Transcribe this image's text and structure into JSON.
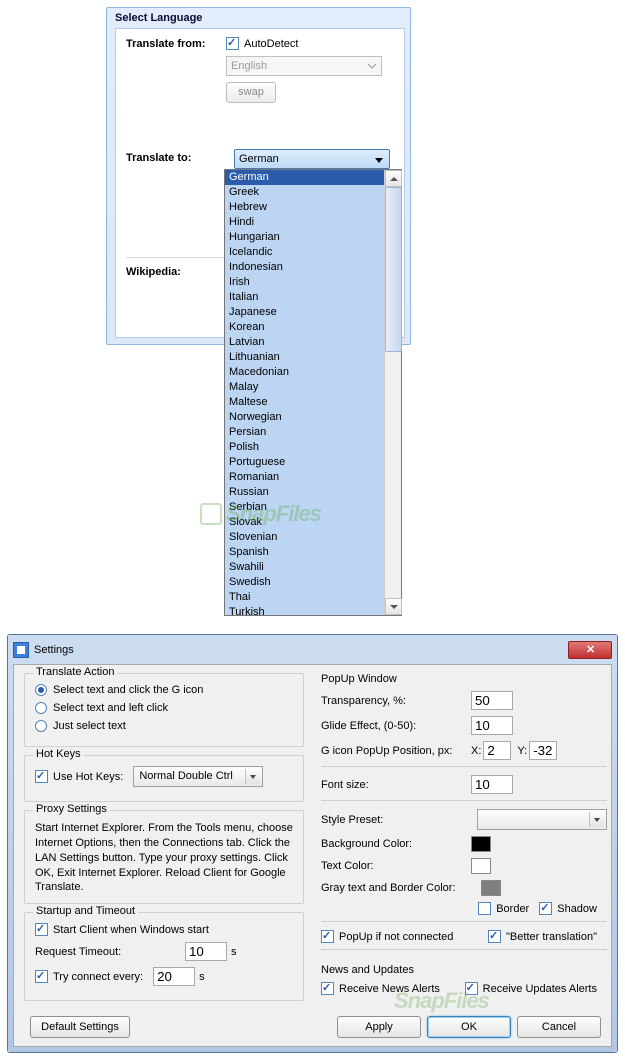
{
  "watermark": "SnapFiles",
  "selectLanguage": {
    "title": "Select Language",
    "fromLabel": "Translate from:",
    "autoDetectLabel": "AutoDetect",
    "autoDetectChecked": true,
    "fromSelected": "English",
    "swapLabel": "swap",
    "toLabel": "Translate to:",
    "toSelected": "German",
    "wikipediaLabel": "Wikipedia:",
    "options": [
      "German",
      "Greek",
      "Hebrew",
      "Hindi",
      "Hungarian",
      "Icelandic",
      "Indonesian",
      "Irish",
      "Italian",
      "Japanese",
      "Korean",
      "Latvian",
      "Lithuanian",
      "Macedonian",
      "Malay",
      "Maltese",
      "Norwegian",
      "Persian",
      "Polish",
      "Portuguese",
      "Romanian",
      "Russian",
      "Serbian",
      "Slovak",
      "Slovenian",
      "Spanish",
      "Swahili",
      "Swedish",
      "Thai",
      "Turkish"
    ]
  },
  "settings": {
    "title": "Settings",
    "translateAction": {
      "legend": "Translate Action",
      "o1": "Select text and click the G icon",
      "o2": "Select text and left click",
      "o3": "Just select text",
      "selected": 0
    },
    "hotKeys": {
      "legend": "Hot Keys",
      "useLabel": "Use Hot Keys:",
      "useChecked": true,
      "modeValue": "Normal Double Ctrl"
    },
    "proxy": {
      "legend": "Proxy Settings",
      "text": "Start Internet Explorer. From the Tools menu, choose Internet Options, then the Connections tab. Click the LAN Settings button. Type your proxy settings. Click OK, Exit Internet Explorer. Reload Client for Google Translate."
    },
    "startup": {
      "legend": "Startup and Timeout",
      "startClientLabel": "Start Client when Windows start",
      "startClientChecked": true,
      "requestTimeoutLabel": "Request Timeout:",
      "requestTimeoutValue": "10",
      "secondsUnit": "s",
      "tryConnectLabel": "Try connect every:",
      "tryConnectChecked": true,
      "tryConnectValue": "20"
    },
    "popup": {
      "legend": "PopUp Window",
      "transparencyLabel": "Transparency, %:",
      "transparencyValue": "50",
      "glideLabel": "Glide Effect, (0-50):",
      "glideValue": "10",
      "giconLabel": "G icon PopUp Position, px:",
      "xLabel": "X:",
      "xValue": "2",
      "yLabel": "Y:",
      "yValue": "-32",
      "fontSizeLabel": "Font size:",
      "fontSizeValue": "10",
      "stylePresetLabel": "Style Preset:",
      "stylePresetValue": "",
      "bgColorLabel": "Background Color:",
      "textColorLabel": "Text Color:",
      "grayBorderLabel": "Gray text and Border Color:",
      "borderLabel": "Border",
      "borderChecked": false,
      "shadowLabel": "Shadow",
      "shadowChecked": true,
      "popupIfNotConnLabel": "PopUp if not connected",
      "popupIfNotConnChecked": true,
      "betterTransLabel": "\"Better translation\"",
      "betterTransChecked": true
    },
    "news": {
      "legend": "News and Updates",
      "newsLabel": "Receive News Alerts",
      "newsChecked": true,
      "updatesLabel": "Receive Updates Alerts",
      "updatesChecked": true
    },
    "buttons": {
      "defaults": "Default Settings",
      "apply": "Apply",
      "ok": "OK",
      "cancel": "Cancel"
    }
  }
}
